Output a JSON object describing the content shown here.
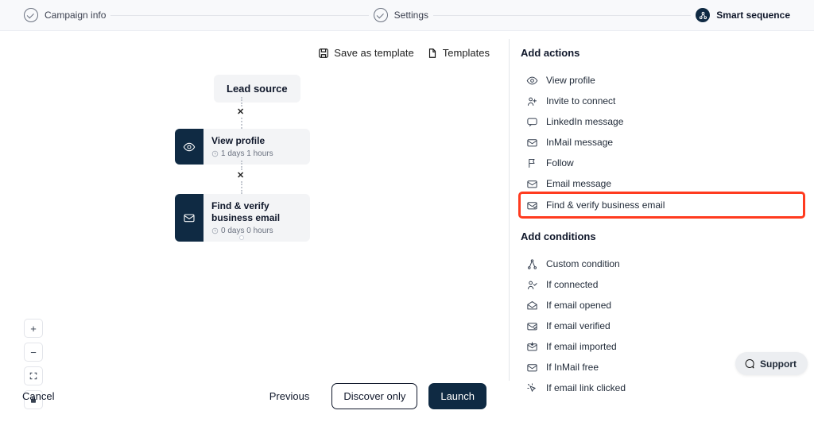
{
  "stepper": {
    "step1": "Campaign info",
    "step2": "Settings",
    "step3": "Smart sequence"
  },
  "toolbar": {
    "save_template": "Save as template",
    "templates": "Templates"
  },
  "flow": {
    "lead_source": "Lead source",
    "view_profile": {
      "title": "View profile",
      "sub": "1 days 1 hours"
    },
    "find_verify": {
      "title": "Find & verify business email",
      "sub": "0 days 0 hours"
    }
  },
  "panel": {
    "actions_title": "Add actions",
    "conditions_title": "Add conditions",
    "actions": {
      "view_profile": "View profile",
      "invite": "Invite to connect",
      "li_message": "LinkedIn message",
      "inmail": "InMail message",
      "follow": "Follow",
      "email_message": "Email message",
      "find_verify": "Find & verify business email"
    },
    "conditions": {
      "custom": "Custom condition",
      "if_connected": "If connected",
      "if_email_opened": "If email opened",
      "if_email_verified": "If email verified",
      "if_email_imported": "If email imported",
      "if_inmail_free": "If InMail free",
      "if_link_clicked": "If email link clicked"
    }
  },
  "footer": {
    "cancel": "Cancel",
    "previous": "Previous",
    "discover": "Discover only",
    "launch": "Launch"
  },
  "support": "Support"
}
